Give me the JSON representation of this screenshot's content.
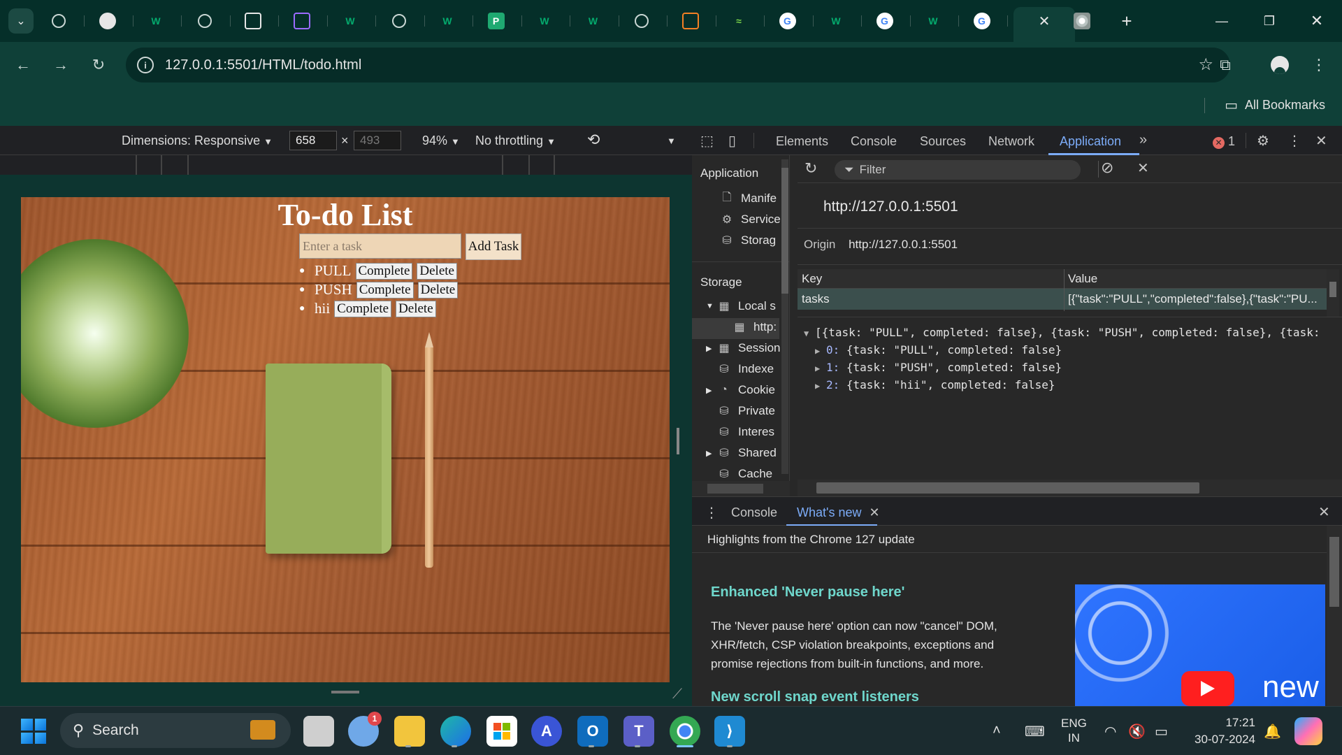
{
  "browser": {
    "tabs": [
      {
        "icon": "globe-icon"
      },
      {
        "icon": "github-icon"
      },
      {
        "icon": "w3schools-icon",
        "glyph": "W"
      },
      {
        "icon": "globe-icon"
      },
      {
        "icon": "codesandbox-icon"
      },
      {
        "icon": "cube-icon"
      },
      {
        "icon": "w3schools-icon",
        "glyph": "W"
      },
      {
        "icon": "globe-icon"
      },
      {
        "icon": "w3schools-icon",
        "glyph": "W"
      },
      {
        "icon": "preview-icon",
        "glyph": "P"
      },
      {
        "icon": "w3schools-icon",
        "glyph": "W"
      },
      {
        "icon": "w3schools-icon",
        "glyph": "W"
      },
      {
        "icon": "globe-icon"
      },
      {
        "icon": "stackoverflow-icon"
      },
      {
        "icon": "equal-tilde-icon",
        "glyph": "≈"
      },
      {
        "icon": "google-icon",
        "glyph": "G"
      },
      {
        "icon": "w3schools-icon",
        "glyph": "W"
      },
      {
        "icon": "google-icon",
        "glyph": "G"
      },
      {
        "icon": "w3schools-icon",
        "glyph": "W"
      },
      {
        "icon": "google-icon",
        "glyph": "G"
      }
    ],
    "address": "127.0.0.1:5501/HTML/todo.html",
    "all_bookmarks": "All Bookmarks",
    "accent": "#0f4038"
  },
  "device_toolbar": {
    "dimensions_label": "Dimensions: Responsive",
    "width": "658",
    "height_placeholder": "493",
    "times": "×",
    "zoom": "94%",
    "throttling": "No throttling"
  },
  "page": {
    "title": "To-do List",
    "input_placeholder": "Enter a task",
    "add_button": "Add Task",
    "tasks": [
      {
        "name": "PULL",
        "complete": "Complete",
        "delete": "Delete"
      },
      {
        "name": "PUSH",
        "complete": "Complete",
        "delete": "Delete"
      },
      {
        "name": "hii",
        "complete": "Complete",
        "delete": "Delete"
      }
    ]
  },
  "devtools": {
    "tabs": [
      "Elements",
      "Console",
      "Sources",
      "Network",
      "Application"
    ],
    "active_tab": "Application",
    "more": "»",
    "error_count": "1",
    "sidebar": {
      "application_heading": "Application",
      "application_items": [
        "Manife",
        "Service",
        "Storag"
      ],
      "storage_heading": "Storage",
      "storage_items": [
        "Local s",
        "http:",
        "Session",
        "Indexe",
        "Cookie",
        "Private",
        "Interes",
        "Shared",
        "Cache"
      ]
    },
    "filter_placeholder": "Filter",
    "origin_heading": "http://127.0.0.1:5501",
    "origin_label": "Origin",
    "origin_value": "http://127.0.0.1:5501",
    "table": {
      "key_header": "Key",
      "value_header": "Value",
      "row_key": "tasks",
      "row_value": "[{\"task\":\"PULL\",\"completed\":false},{\"task\":\"PU..."
    },
    "json_preview": {
      "summary": "[{task: \"PULL\", completed: false}, {task: \"PUSH\", completed: false}, {task:",
      "items": [
        {
          "idx": "0:",
          "text": "{task: \"PULL\", completed: false}"
        },
        {
          "idx": "1:",
          "text": "{task: \"PUSH\", completed: false}"
        },
        {
          "idx": "2:",
          "text": "{task: \"hii\", completed: false}"
        }
      ]
    },
    "drawer": {
      "tabs": [
        "Console",
        "What's new"
      ],
      "active": "What's new",
      "heading": "Highlights from the Chrome 127 update",
      "item1_title": "Enhanced 'Never pause here'",
      "item1_desc": "The 'Never pause here' option can now \"cancel\" DOM, XHR/fetch, CSP violation breakpoints, exceptions and promise rejections from built-in functions, and more.",
      "item2_title": "New scroll snap event listeners",
      "image_text": "new"
    }
  },
  "taskbar": {
    "search_label": "Search",
    "weather_badge": "1",
    "language_line1": "ENG",
    "language_line2": "IN",
    "time": "17:21",
    "date": "30-07-2024"
  }
}
